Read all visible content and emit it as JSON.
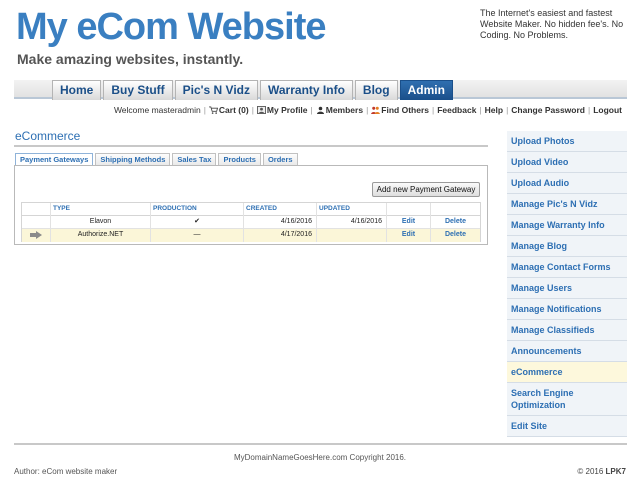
{
  "header": {
    "site_title": "My eCom Website",
    "tagline": "Make amazing websites, instantly.",
    "blurb": "The Internet's easiest and fastest Website Maker. No hidden fee's. No Coding. No Problems."
  },
  "nav": {
    "tabs": [
      {
        "label": "Home"
      },
      {
        "label": "Buy Stuff"
      },
      {
        "label": "Pic's N Vidz"
      },
      {
        "label": "Warranty Info"
      },
      {
        "label": "Blog"
      },
      {
        "label": "Admin"
      }
    ],
    "active": "Admin"
  },
  "userbar": {
    "welcome": "Welcome masteradmin",
    "cart": "Cart (0)",
    "profile": "My Profile",
    "members": "Members",
    "find_others": "Find Others",
    "feedback": "Feedback",
    "help": "Help",
    "change_password": "Change Password",
    "logout": "Logout"
  },
  "main": {
    "title": "eCommerce",
    "subtabs": [
      "Payment Gateways",
      "Shipping Methods",
      "Sales Tax",
      "Products",
      "Orders"
    ],
    "active_subtab": "Payment Gateways",
    "add_button": "Add new Payment Gateway",
    "table": {
      "headers": [
        "TYPE",
        "PRODUCTION",
        "CREATED",
        "UPDATED"
      ],
      "rows": [
        {
          "type": "Elavon",
          "production": "✔",
          "created": "4/16/2016",
          "updated": "4/16/2016",
          "edit": "Edit",
          "delete": "Delete"
        },
        {
          "type": "Authorize.NET",
          "production": "—",
          "created": "4/17/2016",
          "updated": "",
          "edit": "Edit",
          "delete": "Delete"
        }
      ]
    }
  },
  "sidebar": {
    "items": [
      {
        "label": "Upload Photos"
      },
      {
        "label": "Upload Video"
      },
      {
        "label": "Upload Audio"
      },
      {
        "label": "Manage Pic's N Vidz"
      },
      {
        "label": "Manage Warranty Info"
      },
      {
        "label": "Manage Blog"
      },
      {
        "label": "Manage Contact Forms"
      },
      {
        "label": "Manage Users"
      },
      {
        "label": "Manage Notifications"
      },
      {
        "label": "Manage Classifieds"
      },
      {
        "label": "Announcements"
      },
      {
        "label": "eCommerce"
      },
      {
        "label": "Search Engine Optimization"
      },
      {
        "label": "Edit Site"
      }
    ],
    "active": "eCommerce"
  },
  "footer": {
    "copyright": "MyDomainNameGoesHere.com Copyright 2016.",
    "author": "Author: eCom website maker",
    "credit_prefix": "© 2016",
    "credit_brand": "LPK7"
  },
  "colors": {
    "brand_blue": "#3a7fc1",
    "link_blue": "#2d6fb3",
    "active_tab": "#1a4f8a",
    "highlight_row": "#fbf6d8"
  }
}
